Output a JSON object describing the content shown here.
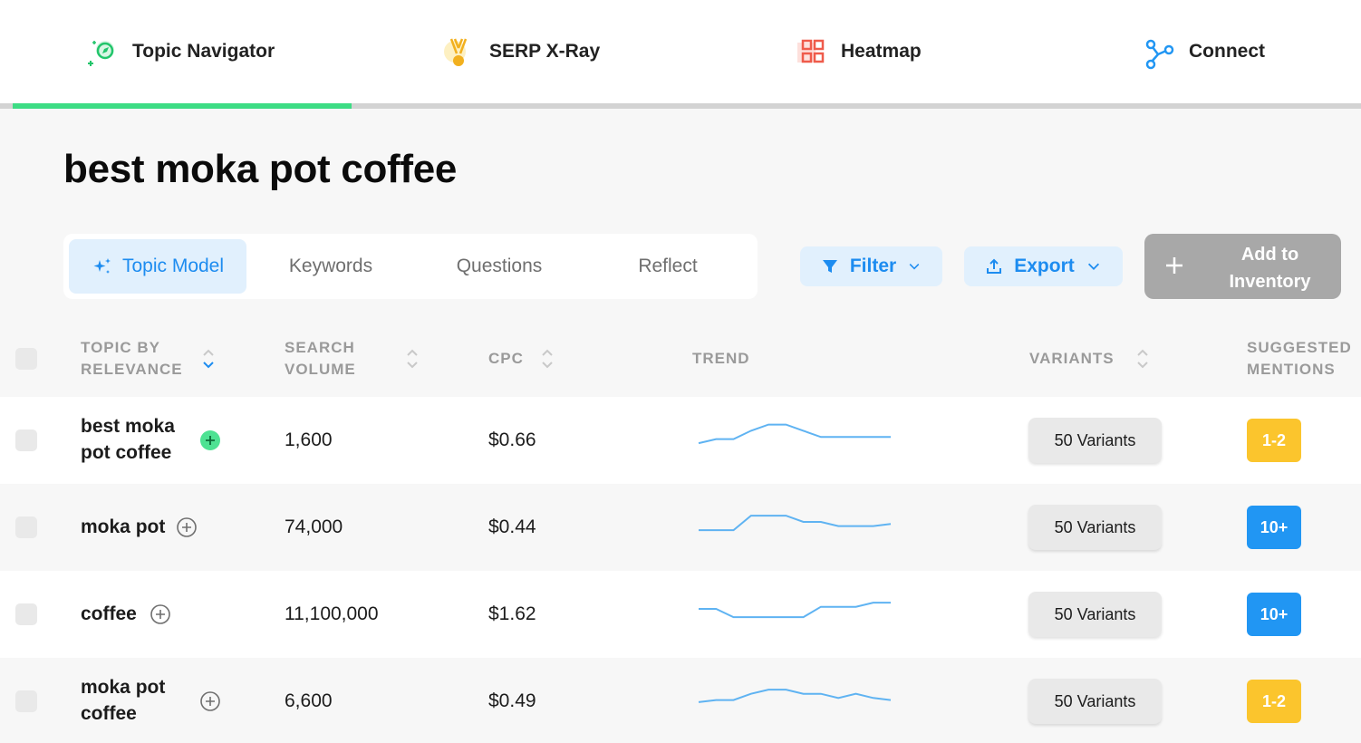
{
  "nav": [
    {
      "label": "Topic Navigator",
      "icon": "compass-sparkle-icon"
    },
    {
      "label": "SERP X-Ray",
      "icon": "medal-icon"
    },
    {
      "label": "Heatmap",
      "icon": "grid-icon"
    },
    {
      "label": "Connect",
      "icon": "connect-nodes-icon"
    }
  ],
  "progress": 0.25,
  "page_title": "best moka pot coffee",
  "tabs": [
    "Topic Model",
    "Keywords",
    "Questions",
    "Reflect"
  ],
  "active_tab": "Topic Model",
  "buttons": {
    "filter": "Filter",
    "export": "Export",
    "add_line1": "Add to",
    "add_line2": "Inventory"
  },
  "headers": {
    "topic_line1": "TOPIC BY",
    "topic_line2": "RELEVANCE",
    "volume_line1": "SEARCH",
    "volume_line2": "VOLUME",
    "cpc": "CPC",
    "trend": "TREND",
    "variants": "VARIANTS",
    "mentions_line1": "SUGGESTED",
    "mentions_line2": "MENTIONS"
  },
  "colors": {
    "accent": "#1d8cf0",
    "green": "#3ddc84",
    "badge_yellow": "#fbc52d",
    "badge_blue": "#2196f3",
    "trend_line": "#5fb3f2"
  },
  "rows": [
    {
      "topic_line1": "best moka",
      "topic_line2": "pot coffee",
      "volume": "1,600",
      "cpc": "$0.66",
      "variants": "50 Variants",
      "mentions": "1-2",
      "trend": [
        3,
        5,
        5,
        9,
        12,
        12,
        9,
        6,
        6,
        6,
        6,
        6
      ],
      "added": true
    },
    {
      "topic_line1": "moka pot",
      "topic_line2": "",
      "volume": "74,000",
      "cpc": "$0.44",
      "variants": "50 Variants",
      "mentions": "10+",
      "trend": [
        3,
        3,
        3,
        10,
        10,
        10,
        7,
        7,
        5,
        5,
        5,
        6
      ],
      "added": false
    },
    {
      "topic_line1": "coffee",
      "topic_line2": "",
      "volume": "11,100,000",
      "cpc": "$1.62",
      "variants": "50 Variants",
      "mentions": "10+",
      "trend": [
        7,
        7,
        3,
        3,
        3,
        3,
        3,
        8,
        8,
        8,
        10,
        10
      ],
      "added": false
    },
    {
      "topic_line1": "moka pot",
      "topic_line2": "coffee",
      "volume": "6,600",
      "cpc": "$0.49",
      "variants": "50 Variants",
      "mentions": "1-2",
      "trend": [
        4,
        5,
        5,
        8,
        10,
        10,
        8,
        8,
        6,
        8,
        6,
        5
      ],
      "added": false
    }
  ]
}
